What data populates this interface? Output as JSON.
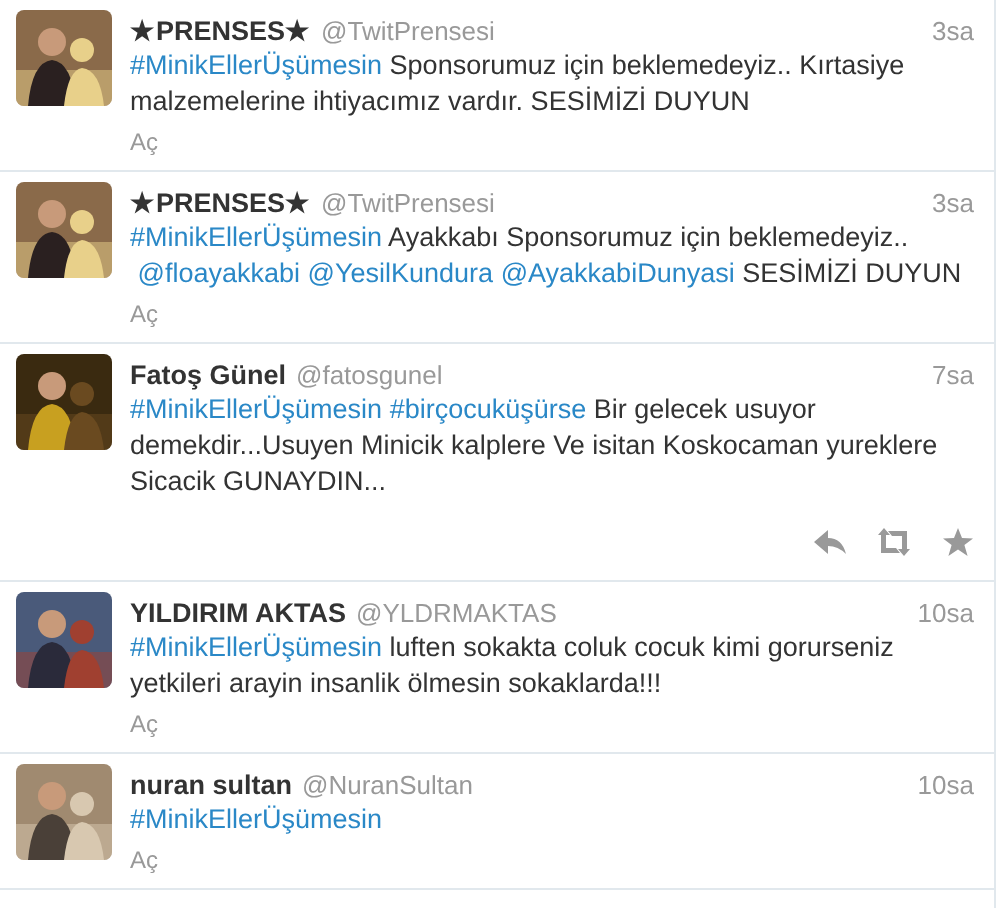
{
  "tweets": [
    {
      "name": "★PRENSES★",
      "handle": "@TwitPrensesi",
      "time": "3sa",
      "hovered": false,
      "expand": "Aç",
      "text": [
        {
          "kind": "hashtag",
          "text": "#MinikEllerÜşümesin"
        },
        {
          "kind": "text",
          "text": " Sponsorumuz için beklemedeyiz.. Kırtasiye malzemelerine ihtiyacımız vardır. SESİMİZİ DUYUN"
        }
      ]
    },
    {
      "name": "★PRENSES★",
      "handle": "@TwitPrensesi",
      "time": "3sa",
      "hovered": false,
      "expand": "Aç",
      "text": [
        {
          "kind": "hashtag",
          "text": "#MinikEllerÜşümesin"
        },
        {
          "kind": "text",
          "text": " Ayakkabı Sponsorumuz için beklemedeyiz.. "
        },
        {
          "kind": "mention",
          "text": "@floayakkabi"
        },
        {
          "kind": "mention",
          "text": "@YesilKundura"
        },
        {
          "kind": "mention",
          "text": "@AyakkabiDunyasi"
        },
        {
          "kind": "text",
          "text": " SESİMİZİ DUYUN"
        }
      ]
    },
    {
      "name": "Fatoş Günel",
      "handle": "@fatosgunel",
      "time": "7sa",
      "hovered": true,
      "text": [
        {
          "kind": "hashtag",
          "text": "#MinikEllerÜşümesin"
        },
        {
          "kind": "hashtag",
          "text": "#birçocuküşürse"
        },
        {
          "kind": "text",
          "text": " Bir gelecek usuyor demekdir...Usuyen Minicik kalplere Ve isitan Koskocaman yureklere Sicacik GUNAYDIN..."
        }
      ]
    },
    {
      "name": "YILDIRIM AKTAS",
      "handle": "@YLDRMAKTAS",
      "time": "10sa",
      "hovered": false,
      "expand": "Aç",
      "text": [
        {
          "kind": "hashtag",
          "text": "#MinikEllerÜşümesin"
        },
        {
          "kind": "text",
          "text": " luften sokakta coluk cocuk kimi gorurseniz yetkileri arayin insanlik ölmesin sokaklarda!!!"
        }
      ]
    },
    {
      "name": "nuran sultan",
      "handle": "@NuranSultan",
      "time": "10sa",
      "hovered": false,
      "expand": "Aç",
      "text": [
        {
          "kind": "hashtag",
          "text": "#MinikEllerÜşümesin"
        }
      ]
    }
  ]
}
